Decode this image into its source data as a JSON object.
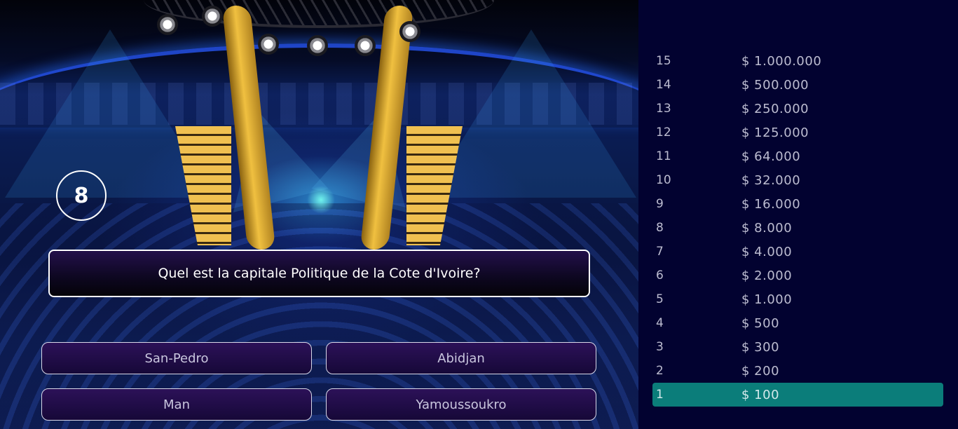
{
  "game": {
    "question_number": "8",
    "question": "Quel est la capitale Politique de la Cote d'Ivoire?",
    "answers": [
      "San-Pedro",
      "Abidjan",
      "Man",
      "Yamoussoukro"
    ]
  },
  "ladder": {
    "current_level": "1",
    "highlight_color": "#0b7d7a",
    "rows": [
      {
        "level": "15",
        "amount": "$ 1.000.000"
      },
      {
        "level": "14",
        "amount": "$ 500.000"
      },
      {
        "level": "13",
        "amount": "$ 250.000"
      },
      {
        "level": "12",
        "amount": "$ 125.000"
      },
      {
        "level": "11",
        "amount": "$ 64.000"
      },
      {
        "level": "10",
        "amount": "$ 32.000"
      },
      {
        "level": "9",
        "amount": "$ 16.000"
      },
      {
        "level": "8",
        "amount": "$ 8.000"
      },
      {
        "level": "7",
        "amount": "$ 4.000"
      },
      {
        "level": "6",
        "amount": "$ 2.000"
      },
      {
        "level": "5",
        "amount": "$ 1.000"
      },
      {
        "level": "4",
        "amount": "$ 500"
      },
      {
        "level": "3",
        "amount": "$ 300"
      },
      {
        "level": "2",
        "amount": "$ 200"
      },
      {
        "level": "1",
        "amount": "$ 100"
      }
    ]
  }
}
